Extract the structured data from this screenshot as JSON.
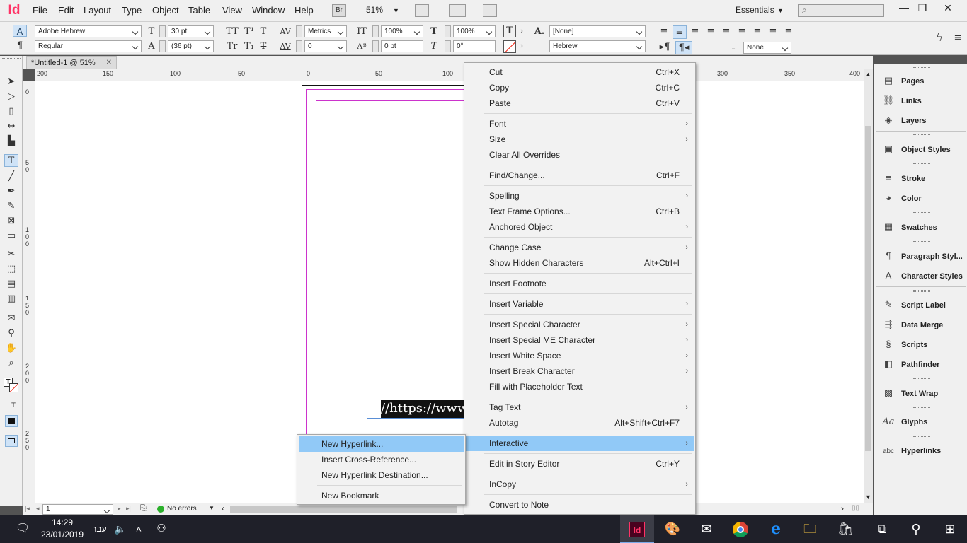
{
  "app": {
    "logo": "Id",
    "bridge_label": "Br",
    "zoom": "51%",
    "workspace": "Essentials"
  },
  "menubar": {
    "items": [
      "File",
      "Edit",
      "Layout",
      "Type",
      "Object",
      "Table",
      "View",
      "Window",
      "Help"
    ]
  },
  "window_buttons": {
    "minimize": "—",
    "restore": "❐",
    "close": "✕"
  },
  "control_panel": {
    "font_family": "Adobe Hebrew",
    "font_style": "Regular",
    "font_size": "30 pt",
    "leading": "(36 pt)",
    "kerning": "Metrics",
    "tracking": "0",
    "vertical_scale": "100%",
    "horizontal_scale": "100%",
    "baseline_shift": "0 pt",
    "skew": "0°",
    "char_style": "[None]",
    "language": "Hebrew",
    "none_dropdown": "None"
  },
  "document": {
    "tab_title": "*Untitled-1 @ 51%",
    "hruler_ticks": [
      "200",
      "150",
      "100",
      "50",
      "0",
      "50",
      "100",
      "300",
      "350",
      "400"
    ],
    "vruler_ticks": [
      "0",
      "5 0",
      "1 0 0",
      "1 5 0",
      "2 0 0",
      "2 5 0"
    ],
    "text_frame_content": "//https://www.p"
  },
  "status": {
    "page": "1",
    "preflight": "No errors"
  },
  "context_menu": {
    "groups": [
      [
        {
          "label": "Cut",
          "shortcut": "Ctrl+X"
        },
        {
          "label": "Copy",
          "shortcut": "Ctrl+C"
        },
        {
          "label": "Paste",
          "shortcut": "Ctrl+V"
        }
      ],
      [
        {
          "label": "Font",
          "submenu": true
        },
        {
          "label": "Size",
          "submenu": true
        },
        {
          "label": "Clear All Overrides"
        }
      ],
      [
        {
          "label": "Find/Change...",
          "shortcut": "Ctrl+F"
        }
      ],
      [
        {
          "label": "Spelling",
          "submenu": true
        },
        {
          "label": "Text Frame Options...",
          "shortcut": "Ctrl+B"
        },
        {
          "label": "Anchored Object",
          "submenu": true
        }
      ],
      [
        {
          "label": "Change Case",
          "submenu": true
        },
        {
          "label": "Show Hidden Characters",
          "shortcut": "Alt+Ctrl+I"
        }
      ],
      [
        {
          "label": "Insert Footnote"
        }
      ],
      [
        {
          "label": "Insert Variable",
          "submenu": true
        }
      ],
      [
        {
          "label": "Insert Special Character",
          "submenu": true
        },
        {
          "label": "Insert Special ME Character",
          "submenu": true
        },
        {
          "label": "Insert White Space",
          "submenu": true
        },
        {
          "label": "Insert Break Character",
          "submenu": true
        },
        {
          "label": "Fill with Placeholder Text"
        }
      ],
      [
        {
          "label": "Tag Text",
          "submenu": true
        },
        {
          "label": "Autotag",
          "shortcut": "Alt+Shift+Ctrl+F7"
        }
      ],
      [
        {
          "label": "Interactive",
          "submenu": true,
          "highlighted": true
        }
      ],
      [
        {
          "label": "Edit in Story Editor",
          "shortcut": "Ctrl+Y"
        }
      ],
      [
        {
          "label": "InCopy",
          "submenu": true
        }
      ],
      [
        {
          "label": "Convert to Note"
        }
      ]
    ]
  },
  "submenu": {
    "items": [
      {
        "label": "New Hyperlink...",
        "highlighted": true
      },
      {
        "label": "Insert Cross-Reference..."
      },
      {
        "label": "New Hyperlink Destination..."
      },
      {
        "label": "New Bookmark"
      }
    ]
  },
  "right_panel": {
    "groups": [
      [
        {
          "label": "Pages",
          "icon": "pages-icon"
        },
        {
          "label": "Links",
          "icon": "links-icon"
        },
        {
          "label": "Layers",
          "icon": "layers-icon"
        }
      ],
      [
        {
          "label": "Object Styles",
          "icon": "object-styles-icon"
        }
      ],
      [
        {
          "label": "Stroke",
          "icon": "stroke-icon"
        },
        {
          "label": "Color",
          "icon": "color-icon"
        }
      ],
      [
        {
          "label": "Swatches",
          "icon": "swatches-icon"
        }
      ],
      [
        {
          "label": "Paragraph Styl...",
          "icon": "paragraph-styles-icon"
        },
        {
          "label": "Character Styles",
          "icon": "character-styles-icon"
        }
      ],
      [
        {
          "label": "Script Label",
          "icon": "script-label-icon"
        },
        {
          "label": "Data Merge",
          "icon": "data-merge-icon"
        },
        {
          "label": "Scripts",
          "icon": "scripts-icon"
        },
        {
          "label": "Pathfinder",
          "icon": "pathfinder-icon"
        }
      ],
      [
        {
          "label": "Text Wrap",
          "icon": "text-wrap-icon"
        }
      ],
      [
        {
          "label": "Glyphs",
          "icon": "glyphs-icon"
        }
      ],
      [
        {
          "label": "Hyperlinks",
          "icon": "hyperlinks-icon"
        }
      ]
    ]
  },
  "taskbar": {
    "time": "14:29",
    "date": "23/01/2019",
    "language": "עבר"
  },
  "colors": {
    "menu_highlight": "#91c9f7",
    "indesign_pink": "#ff3366",
    "margin_guide": "#cc33cc",
    "taskbar": "#1f2029"
  }
}
